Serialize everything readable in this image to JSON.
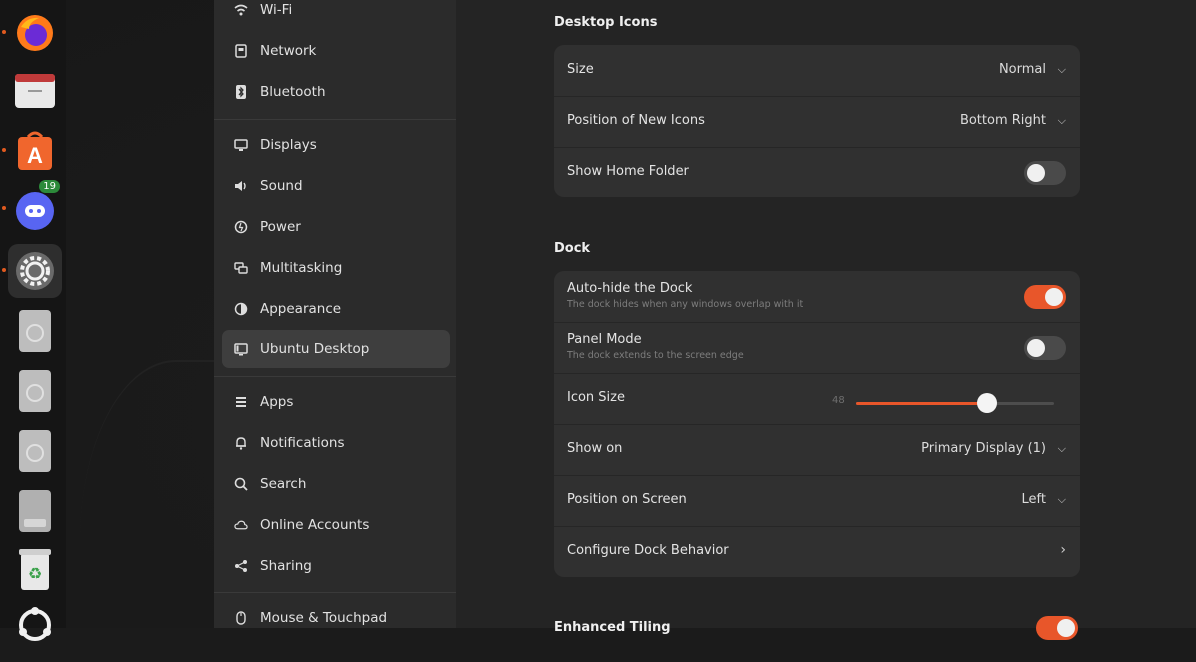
{
  "dock": {
    "items": [
      {
        "name": "firefox",
        "badge": ""
      },
      {
        "name": "files",
        "badge": ""
      },
      {
        "name": "app-center",
        "badge": ""
      },
      {
        "name": "discord",
        "badge": "19"
      },
      {
        "name": "settings",
        "badge": ""
      },
      {
        "name": "drive-1",
        "badge": ""
      },
      {
        "name": "drive-2",
        "badge": ""
      },
      {
        "name": "drive-3",
        "badge": ""
      },
      {
        "name": "drive-4",
        "badge": ""
      },
      {
        "name": "trash",
        "badge": ""
      },
      {
        "name": "ubuntu-apps",
        "badge": ""
      }
    ]
  },
  "sidebar": {
    "items": [
      {
        "label": "Wi-Fi",
        "icon": "wifi-icon"
      },
      {
        "label": "Network",
        "icon": "network-icon"
      },
      {
        "label": "Bluetooth",
        "icon": "bluetooth-icon"
      },
      {
        "label": "Displays",
        "icon": "display-icon"
      },
      {
        "label": "Sound",
        "icon": "sound-icon"
      },
      {
        "label": "Power",
        "icon": "power-icon"
      },
      {
        "label": "Multitasking",
        "icon": "multitasking-icon"
      },
      {
        "label": "Appearance",
        "icon": "appearance-icon"
      },
      {
        "label": "Ubuntu Desktop",
        "icon": "ubuntu-desktop-icon"
      },
      {
        "label": "Apps",
        "icon": "apps-icon"
      },
      {
        "label": "Notifications",
        "icon": "bell-icon"
      },
      {
        "label": "Search",
        "icon": "search-icon"
      },
      {
        "label": "Online Accounts",
        "icon": "cloud-icon"
      },
      {
        "label": "Sharing",
        "icon": "share-icon"
      },
      {
        "label": "Mouse & Touchpad",
        "icon": "mouse-icon"
      }
    ],
    "selected": "Ubuntu Desktop"
  },
  "desktop_icons": {
    "title": "Desktop Icons",
    "size_label": "Size",
    "size_value": "Normal",
    "position_label": "Position of New Icons",
    "position_value": "Bottom Right",
    "home_folder_label": "Show Home Folder",
    "home_folder_on": false
  },
  "dock_settings": {
    "title": "Dock",
    "autohide_label": "Auto-hide the Dock",
    "autohide_sub": "The dock hides when any windows overlap with it",
    "autohide_on": true,
    "panel_label": "Panel Mode",
    "panel_sub": "The dock extends to the screen edge",
    "panel_on": false,
    "icon_size_label": "Icon Size",
    "icon_size_value": "48",
    "icon_size_fraction": 0.66,
    "show_on_label": "Show on",
    "show_on_value": "Primary Display (1)",
    "position_label": "Position on Screen",
    "position_value": "Left",
    "configure_label": "Configure Dock Behavior"
  },
  "enhanced_tiling": {
    "title": "Enhanced Tiling",
    "on": true
  },
  "colors": {
    "accent": "#e8562a",
    "sidebar_bg": "#2b2b2b",
    "main_bg": "#242424",
    "card_bg": "#303030"
  }
}
